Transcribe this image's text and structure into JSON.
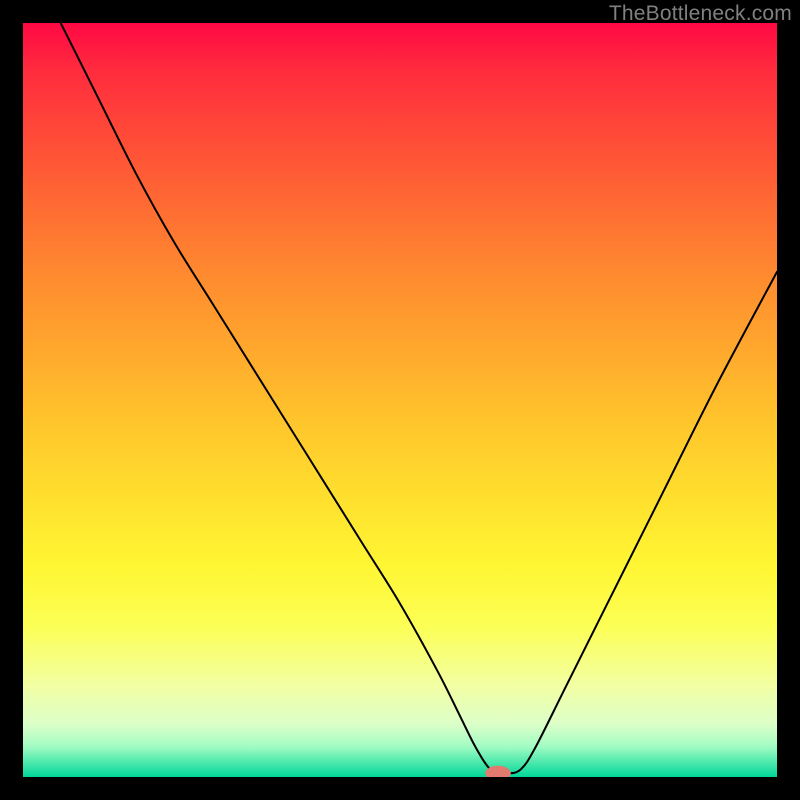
{
  "watermark": "TheBottleneck.com",
  "colors": {
    "frame": "#000000",
    "curve": "#000000",
    "marker": "#e27a70",
    "watermark_text": "#808080"
  },
  "chart_data": {
    "type": "line",
    "title": "",
    "xlabel": "",
    "ylabel": "",
    "xlim": [
      0,
      100
    ],
    "ylim": [
      0,
      100
    ],
    "grid": false,
    "legend": false,
    "series": [
      {
        "name": "bottleneck-curve",
        "comment": "Values are percent of plot width (x) and percent of plot height (y) measured from the bottom edge. The curve dips to ~0 near x≈62–65 and rises steeply on both sides.",
        "x": [
          5,
          10,
          15,
          20,
          25,
          30,
          35,
          40,
          45,
          50,
          55,
          58,
          60,
          62,
          64,
          66,
          68,
          72,
          78,
          85,
          92,
          100
        ],
        "y": [
          100,
          90,
          80,
          71,
          63,
          55,
          47,
          39,
          31,
          23,
          14,
          8,
          4,
          1,
          0.5,
          1,
          4,
          12,
          24,
          38,
          52,
          67
        ]
      }
    ],
    "marker": {
      "comment": "Highlighted minimum marker near the valley floor.",
      "x": 63,
      "y": 0.5,
      "rx_pct": 1.7,
      "ry_pct": 1.0
    }
  }
}
